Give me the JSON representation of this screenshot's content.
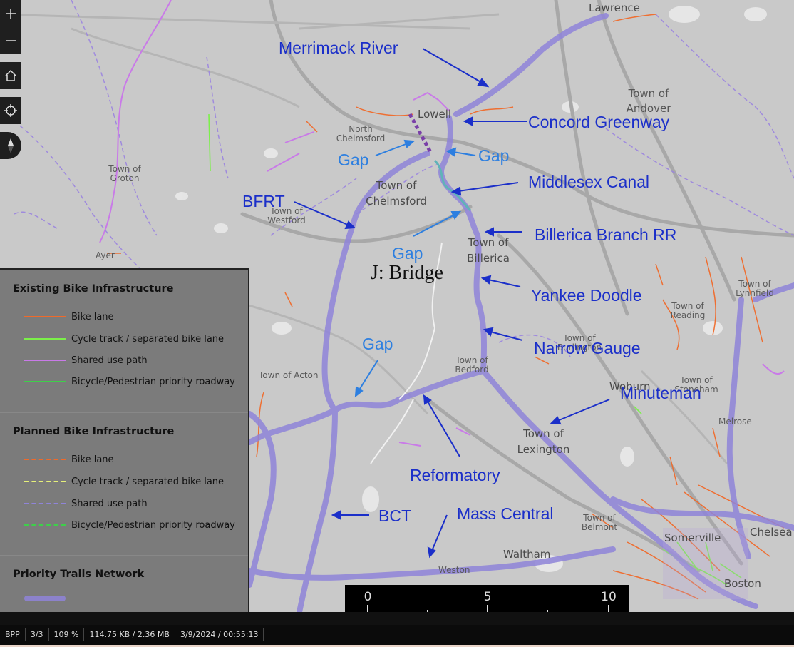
{
  "colors": {
    "map_bg": "#c9c9c9",
    "trail_priority": "#8f84d9",
    "bike_lane": "#f06a2a",
    "cycle_track": "#7cf04a",
    "shared_use": "#c97ae8",
    "ped_priority": "#3ecf4a",
    "annotation_blue": "#1b2fc9",
    "annotation_gap": "#2d7fe0"
  },
  "toolbar": {
    "zoom_in_icon": "plus-icon",
    "zoom_out_icon": "minus-icon",
    "home_icon": "home-icon",
    "locate_icon": "crosshair-icon",
    "compass_icon": "compass-icon"
  },
  "places": {
    "lawrence": "Lawrence",
    "lowell": "Lowell",
    "north_chelmsford": "North\nChelmsford",
    "andover": "Town of\nAndover",
    "groton": "Town of\nGroton",
    "chelmsford": "Town of\nChelmsford",
    "westford": "Town of\nWestford",
    "billerica": "Town of\nBillerica",
    "ayer": "Ayer",
    "lynnfield": "Town of\nLynnfield",
    "reading": "Town of\nReading",
    "burlington": "Town of\nBurlington",
    "bedford": "Town of\nBedford",
    "acton": "Town of Acton",
    "woburn": "Woburn",
    "stoneham": "Town of\nStoneham",
    "melrose": "Melrose",
    "lexington": "Town of\nLexington",
    "belmont": "Town of\nBelmont",
    "somerville": "Somerville",
    "chelsea": "Chelsea",
    "waltham": "Waltham",
    "weston": "Weston",
    "boston": "Boston"
  },
  "annotations": {
    "merrimack": "Merrimack River",
    "concord_greenway": "Concord Greenway",
    "gap_left": "Gap",
    "gap_right": "Gap",
    "middlesex_canal": "Middlesex Canal",
    "bfrt": "BFRT",
    "billerica_branch": "Billerica Branch RR",
    "gap_mid": "Gap",
    "bridge": "J: Bridge",
    "yankee_doodle": "Yankee Doodle",
    "narrow_gauge": "Narrow Gauge",
    "gap_low": "Gap",
    "minuteman": "Minuteman",
    "reformatory": "Reformatory",
    "bct": "BCT",
    "mass_central": "Mass Central"
  },
  "legend": {
    "existing_title": "Existing Bike Infrastructure",
    "existing": [
      {
        "label": "Bike lane",
        "color": "#f06a2a",
        "style": "solid"
      },
      {
        "label": "Cycle track / separated bike lane",
        "color": "#7cf04a",
        "style": "solid"
      },
      {
        "label": "Shared use path",
        "color": "#c97ae8",
        "style": "solid"
      },
      {
        "label": "Bicycle/Pedestrian priority roadway",
        "color": "#3ecf4a",
        "style": "solid"
      }
    ],
    "planned_title": "Planned Bike Infrastructure",
    "planned": [
      {
        "label": "Bike lane",
        "color": "#f06a2a",
        "style": "dashed"
      },
      {
        "label": "Cycle track / separated bike lane",
        "color": "#e6f07a",
        "style": "dashed"
      },
      {
        "label": "Shared use path",
        "color": "#8f84d9",
        "style": "dashed"
      },
      {
        "label": "Bicycle/Pedestrian priority roadway",
        "color": "#3ecf4a",
        "style": "dashed"
      }
    ],
    "priority_title": "Priority Trails Network"
  },
  "scale": {
    "labels": [
      "0",
      "5",
      "10"
    ]
  },
  "status": {
    "format": "BPP",
    "page": "3/3",
    "zoom": "109 %",
    "size": "114.75 KB / 2.36 MB",
    "datetime": "3/9/2024 / 00:55:13"
  }
}
